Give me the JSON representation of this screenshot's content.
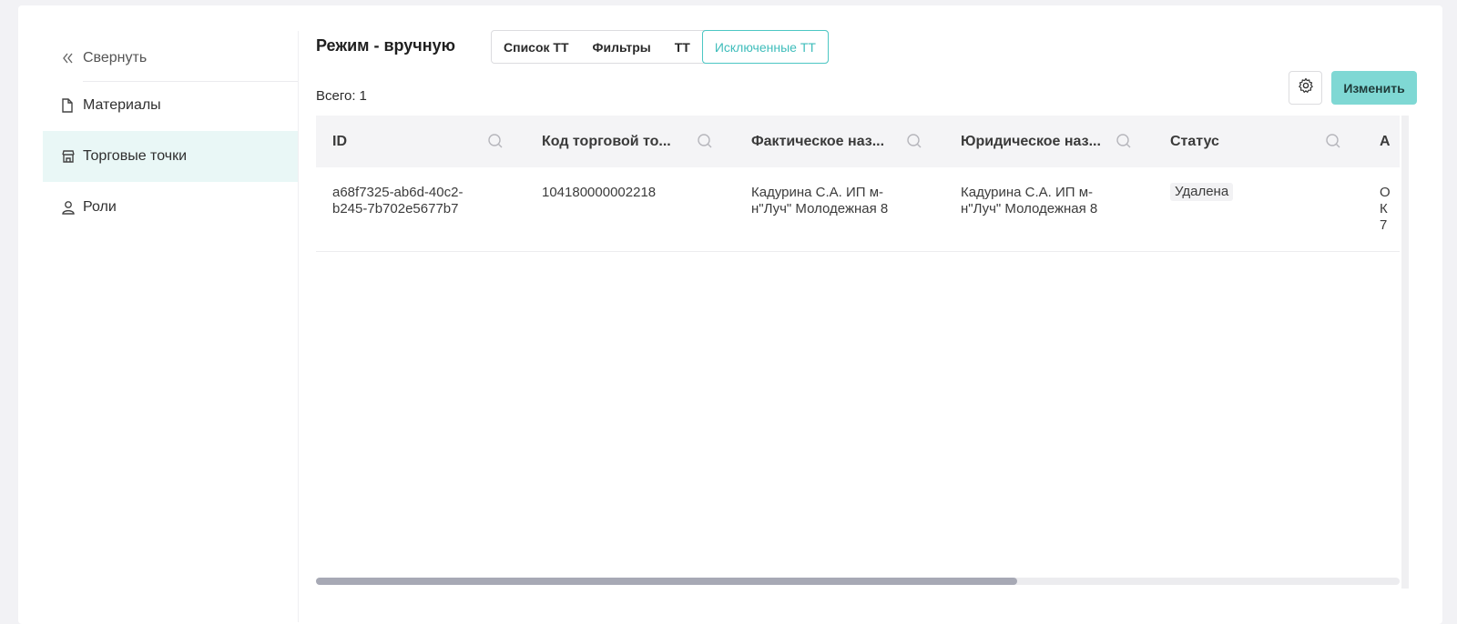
{
  "sidebar": {
    "collapse_label": "Свернуть",
    "items": [
      {
        "label": "Материалы",
        "icon": "file-icon"
      },
      {
        "label": "Торговые точки",
        "icon": "store-icon",
        "active": true
      },
      {
        "label": "Роли",
        "icon": "user-icon"
      }
    ]
  },
  "header": {
    "mode_title": "Режим - вручную",
    "tabs": [
      {
        "label": "Список ТТ"
      },
      {
        "label": "Фильтры"
      },
      {
        "label": "ТТ"
      },
      {
        "label": "Исключенные ТТ",
        "active": true
      }
    ]
  },
  "summary": {
    "total_label": "Всего:",
    "total_value": "1"
  },
  "toolbar": {
    "settings_icon": "gear-icon",
    "edit_label": "Изменить"
  },
  "table": {
    "columns": [
      "ID",
      "Код торговой то...",
      "Фактическое наз...",
      "Юридическое наз...",
      "Статус",
      "А"
    ],
    "rows": [
      {
        "id": "a68f7325-ab6d-40c2-b245-7b702e5677b7",
        "code": "104180000002218",
        "actual_name": "Кадурина С.А. ИП м-н\"Луч\" Молодежная 8",
        "legal_name": "Кадурина С.А. ИП м-н\"Луч\" Молодежная 8",
        "status": "Удалена",
        "address_partial": "О К 7"
      }
    ]
  },
  "colors": {
    "accent": "#4cc7c4",
    "button": "#7fd8d4",
    "active_bg": "#e9f7f6"
  }
}
